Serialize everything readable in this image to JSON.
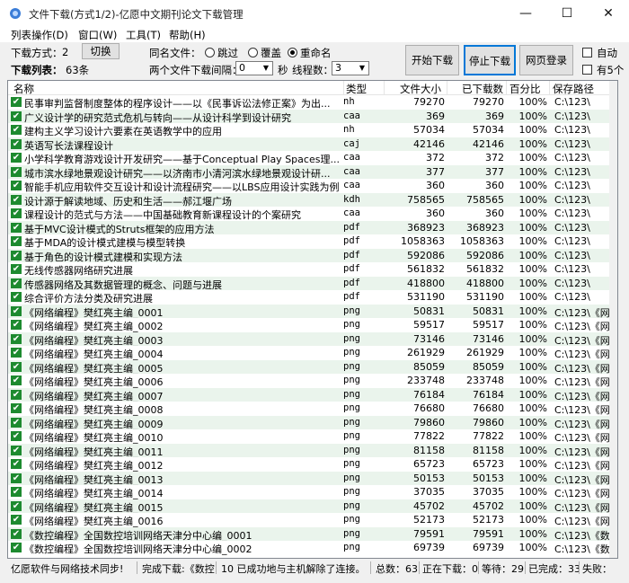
{
  "window": {
    "title": "文件下载(方式1/2)-亿愿中文期刊论文下载管理",
    "minimize": "—",
    "maximize": "☐",
    "close": "✕"
  },
  "menu": [
    "列表操作(D)",
    "窗口(W)",
    "工具(T)",
    "帮助(H)"
  ],
  "toolbar": {
    "mode_label": "下载方式：",
    "mode_value": "2",
    "switch_label": "切换",
    "list_label": "下载列表：",
    "list_count": "63条",
    "samename_label": "同名文件：",
    "opt_skip": "跳过",
    "opt_overwrite": "覆盖",
    "opt_rename": "重命名",
    "interval_label": "两个文件下载间隔：",
    "interval_value": "0",
    "sec_label": "秒",
    "threads_label": "线程数：",
    "threads_value": "3",
    "start_label": "开始下载",
    "stop_label": "停止下载",
    "weblogin_label": "网页登录",
    "auto_label": "自动",
    "have5_label": "有5个"
  },
  "columns": {
    "name": "名称",
    "type": "类型",
    "size": "文件大小",
    "done": "已下载数",
    "pct": "百分比",
    "path": "保存路径"
  },
  "rows": [
    {
      "name": "民事审判监督制度整体的程序设计——以《民事诉讼法修正案》为出...",
      "type": "nh",
      "size": "79270",
      "done": "79270",
      "pct": "100%",
      "path": "C:\\123\\"
    },
    {
      "name": "广义设计学的研究范式危机与转向——从设计科学到设计研究",
      "type": "caa",
      "size": "369",
      "done": "369",
      "pct": "100%",
      "path": "C:\\123\\"
    },
    {
      "name": "建构主义学习设计六要素在英语教学中的应用",
      "type": "nh",
      "size": "57034",
      "done": "57034",
      "pct": "100%",
      "path": "C:\\123\\"
    },
    {
      "name": "英语写长法课程设计",
      "type": "caj",
      "size": "42146",
      "done": "42146",
      "pct": "100%",
      "path": "C:\\123\\"
    },
    {
      "name": "小学科学教育游戏设计开发研究——基于Conceptual Play Spaces理...",
      "type": "caa",
      "size": "372",
      "done": "372",
      "pct": "100%",
      "path": "C:\\123\\"
    },
    {
      "name": "城市滨水绿地景观设计研究——以济南市小清河滨水绿地景观设计研...",
      "type": "caa",
      "size": "377",
      "done": "377",
      "pct": "100%",
      "path": "C:\\123\\"
    },
    {
      "name": "智能手机应用软件交互设计和设计流程研究——以LBS应用设计实践为例",
      "type": "caa",
      "size": "360",
      "done": "360",
      "pct": "100%",
      "path": "C:\\123\\"
    },
    {
      "name": "设计源于解读地域、历史和生活——郝江堰广场",
      "type": "kdh",
      "size": "758565",
      "done": "758565",
      "pct": "100%",
      "path": "C:\\123\\"
    },
    {
      "name": "课程设计的范式与方法——中国基础教育新课程设计的个案研究",
      "type": "caa",
      "size": "360",
      "done": "360",
      "pct": "100%",
      "path": "C:\\123\\"
    },
    {
      "name": "基于MVC设计模式的Struts框架的应用方法",
      "type": "pdf",
      "size": "368923",
      "done": "368923",
      "pct": "100%",
      "path": "C:\\123\\"
    },
    {
      "name": "基于MDA的设计模式建模与模型转换",
      "type": "pdf",
      "size": "1058363",
      "done": "1058363",
      "pct": "100%",
      "path": "C:\\123\\"
    },
    {
      "name": "基于角色的设计模式建模和实现方法",
      "type": "pdf",
      "size": "592086",
      "done": "592086",
      "pct": "100%",
      "path": "C:\\123\\"
    },
    {
      "name": "无线传感器网络研究进展",
      "type": "pdf",
      "size": "561832",
      "done": "561832",
      "pct": "100%",
      "path": "C:\\123\\"
    },
    {
      "name": "传感器网络及其数据管理的概念、问题与进展",
      "type": "pdf",
      "size": "418800",
      "done": "418800",
      "pct": "100%",
      "path": "C:\\123\\"
    },
    {
      "name": "综合评价方法分类及研究进展",
      "type": "pdf",
      "size": "531190",
      "done": "531190",
      "pct": "100%",
      "path": "C:\\123\\"
    },
    {
      "name": "《网络编程》樊红亮主编_0001",
      "type": "png",
      "size": "50831",
      "done": "50831",
      "pct": "100%",
      "path": "C:\\123\\《网"
    },
    {
      "name": "《网络编程》樊红亮主编_0002",
      "type": "png",
      "size": "59517",
      "done": "59517",
      "pct": "100%",
      "path": "C:\\123\\《网"
    },
    {
      "name": "《网络编程》樊红亮主编_0003",
      "type": "png",
      "size": "73146",
      "done": "73146",
      "pct": "100%",
      "path": "C:\\123\\《网"
    },
    {
      "name": "《网络编程》樊红亮主编_0004",
      "type": "png",
      "size": "261929",
      "done": "261929",
      "pct": "100%",
      "path": "C:\\123\\《网"
    },
    {
      "name": "《网络编程》樊红亮主编_0005",
      "type": "png",
      "size": "85059",
      "done": "85059",
      "pct": "100%",
      "path": "C:\\123\\《网"
    },
    {
      "name": "《网络编程》樊红亮主编_0006",
      "type": "png",
      "size": "233748",
      "done": "233748",
      "pct": "100%",
      "path": "C:\\123\\《网"
    },
    {
      "name": "《网络编程》樊红亮主编_0007",
      "type": "png",
      "size": "76184",
      "done": "76184",
      "pct": "100%",
      "path": "C:\\123\\《网"
    },
    {
      "name": "《网络编程》樊红亮主编_0008",
      "type": "png",
      "size": "76680",
      "done": "76680",
      "pct": "100%",
      "path": "C:\\123\\《网"
    },
    {
      "name": "《网络编程》樊红亮主编_0009",
      "type": "png",
      "size": "79860",
      "done": "79860",
      "pct": "100%",
      "path": "C:\\123\\《网"
    },
    {
      "name": "《网络编程》樊红亮主编_0010",
      "type": "png",
      "size": "77822",
      "done": "77822",
      "pct": "100%",
      "path": "C:\\123\\《网"
    },
    {
      "name": "《网络编程》樊红亮主编_0011",
      "type": "png",
      "size": "81158",
      "done": "81158",
      "pct": "100%",
      "path": "C:\\123\\《网"
    },
    {
      "name": "《网络编程》樊红亮主编_0012",
      "type": "png",
      "size": "65723",
      "done": "65723",
      "pct": "100%",
      "path": "C:\\123\\《网"
    },
    {
      "name": "《网络编程》樊红亮主编_0013",
      "type": "png",
      "size": "50153",
      "done": "50153",
      "pct": "100%",
      "path": "C:\\123\\《网"
    },
    {
      "name": "《网络编程》樊红亮主编_0014",
      "type": "png",
      "size": "37035",
      "done": "37035",
      "pct": "100%",
      "path": "C:\\123\\《网"
    },
    {
      "name": "《网络编程》樊红亮主编_0015",
      "type": "png",
      "size": "45702",
      "done": "45702",
      "pct": "100%",
      "path": "C:\\123\\《网"
    },
    {
      "name": "《网络编程》樊红亮主编_0016",
      "type": "png",
      "size": "52173",
      "done": "52173",
      "pct": "100%",
      "path": "C:\\123\\《网"
    },
    {
      "name": "《数控编程》全国数控培训网络天津分中心编_0001",
      "type": "png",
      "size": "79591",
      "done": "79591",
      "pct": "100%",
      "path": "C:\\123\\《数"
    },
    {
      "name": "《数控编程》全国数控培训网络天津分中心编_0002",
      "type": "png",
      "size": "69739",
      "done": "69739",
      "pct": "100%",
      "path": "C:\\123\\《数"
    }
  ],
  "status": {
    "brand": "亿愿软件与网络技术同步!",
    "done_msg": "完成下载:《数控",
    "log_msg": "10 已成功地与主机解除了连接。",
    "total": "总数：63",
    "downloading": "正在下载：0",
    "waiting": "等待：29",
    "completed": "已完成：33",
    "failed": "失败："
  },
  "colors": {
    "check": "#1d8a2f",
    "alt_row": "#eaf4ec"
  }
}
